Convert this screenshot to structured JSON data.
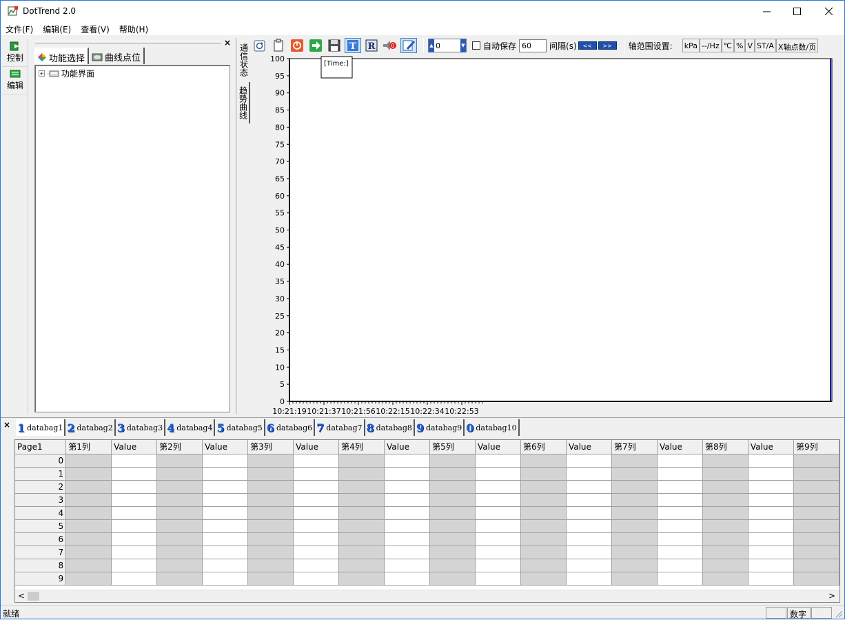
{
  "app": {
    "title": "DotTrend 2.0"
  },
  "menu": [
    "文件(F)",
    "编辑(E)",
    "查看(V)",
    "帮助(H)"
  ],
  "leftnav": [
    {
      "label": "控制",
      "icon": "control-icon"
    },
    {
      "label": "编辑",
      "icon": "edit-icon"
    }
  ],
  "treepanel": {
    "tabs": [
      {
        "label": "功能选择",
        "icon": "function-select-icon"
      },
      {
        "label": "曲线点位",
        "icon": "curve-point-icon"
      }
    ],
    "tree": [
      {
        "label": "功能界面",
        "expander": "+"
      }
    ]
  },
  "vtabs": [
    "通信状态",
    "趋势曲线"
  ],
  "toolbar": {
    "spin_value": "0",
    "autosave_label": "自动保存",
    "interval_value": "60",
    "interval_label": "间隔(s)",
    "prev_label": "<<",
    "next_label": ">>",
    "axis_range_label": "轴范围设置:",
    "units": [
      "kPa",
      "--/Hz",
      "℃",
      "%",
      "V",
      "ST/A",
      "X轴点数/页"
    ]
  },
  "chart_data": {
    "type": "line",
    "ylim": [
      0,
      100
    ],
    "yticks": [
      0,
      5,
      10,
      15,
      20,
      25,
      30,
      35,
      40,
      45,
      50,
      55,
      60,
      65,
      70,
      75,
      80,
      85,
      90,
      95,
      100
    ],
    "xticks": [
      "10:21:19",
      "10:21:37",
      "10:21:56",
      "10:22:15",
      "10:22:34",
      "10:22:53"
    ],
    "tooltip": "[Time:]",
    "series": []
  },
  "bottom": {
    "tabs": [
      {
        "num": "1",
        "label": "databag1"
      },
      {
        "num": "2",
        "label": "databag2"
      },
      {
        "num": "3",
        "label": "databag3"
      },
      {
        "num": "4",
        "label": "databag4"
      },
      {
        "num": "5",
        "label": "databag5"
      },
      {
        "num": "6",
        "label": "databag6"
      },
      {
        "num": "7",
        "label": "databag7"
      },
      {
        "num": "8",
        "label": "databag8"
      },
      {
        "num": "9",
        "label": "databag9"
      },
      {
        "num": "0",
        "label": "databag10"
      }
    ],
    "corner": "Page1",
    "columns": [
      "第1列",
      "Value",
      "第2列",
      "Value",
      "第3列",
      "Value",
      "第4列",
      "Value",
      "第5列",
      "Value",
      "第6列",
      "Value",
      "第7列",
      "Value",
      "第8列",
      "Value",
      "第9列"
    ],
    "rows": [
      "0",
      "1",
      "2",
      "3",
      "4",
      "5",
      "6",
      "7",
      "8",
      "9"
    ],
    "close_label": "×"
  },
  "status": {
    "text": "就绪",
    "num_label": "数字"
  },
  "colors": {
    "accent": "#2b79d6",
    "grid_gray": "#d4d4d4",
    "tab_number": "#1f5fd4"
  }
}
